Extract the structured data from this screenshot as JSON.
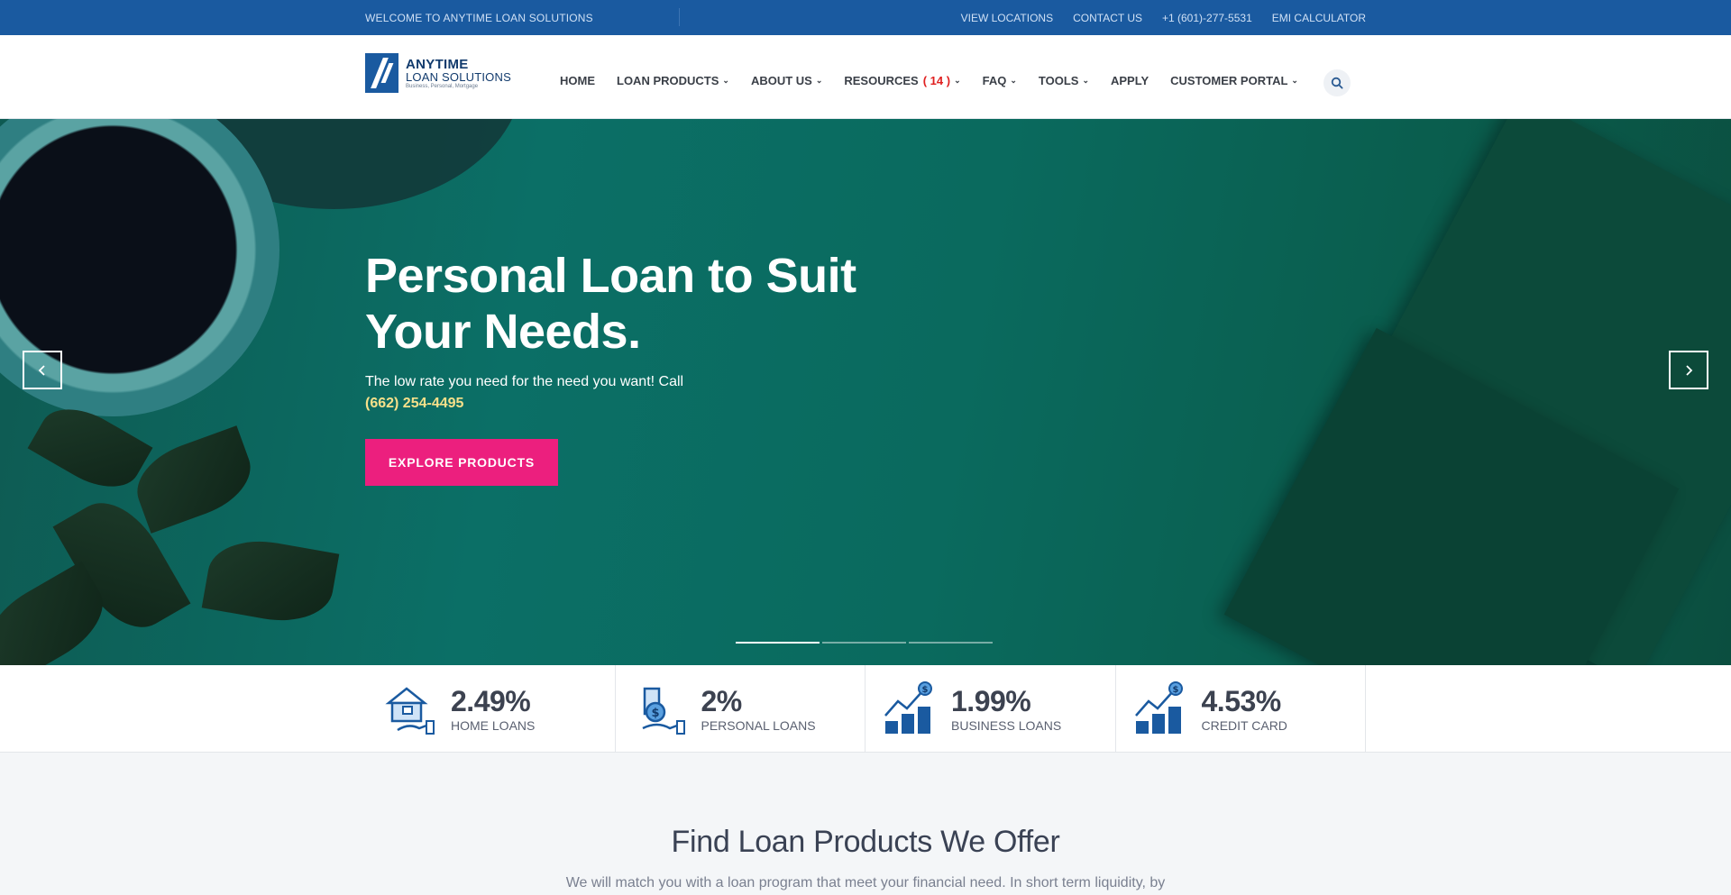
{
  "topbar": {
    "welcome": "WELCOME TO ANYTIME LOAN SOLUTIONS",
    "links": [
      "VIEW LOCATIONS",
      "CONTACT US",
      "+1 (601)-277-5531",
      "EMI CALCULATOR"
    ]
  },
  "logo": {
    "line1": "ANYTIME",
    "line2": "LOAN SOLUTIONS",
    "line3": "Business, Personal, Mortgage"
  },
  "nav": {
    "home": "HOME",
    "loan_products": "LOAN PRODUCTS",
    "about_us": "ABOUT US",
    "resources": "RESOURCES",
    "resources_count": "( 14 )",
    "faq": "FAQ",
    "tools": "TOOLS",
    "apply": "APPLY",
    "customer_portal": "CUSTOMER PORTAL"
  },
  "hero": {
    "title_line1": "Personal Loan to Suit",
    "title_line2": "Your Needs.",
    "subtitle": "The low rate you need for the need you want! Call",
    "phone": "(662) 254-4495",
    "cta": "EXPLORE PRODUCTS",
    "slide_count": 3,
    "active_slide": 1
  },
  "rates": [
    {
      "value": "2.49%",
      "label": "HOME LOANS",
      "icon": "home-loan-icon"
    },
    {
      "value": "2%",
      "label": "PERSONAL LOANS",
      "icon": "personal-loan-icon"
    },
    {
      "value": "1.99%",
      "label": "BUSINESS LOANS",
      "icon": "business-loan-icon"
    },
    {
      "value": "4.53%",
      "label": "CREDIT CARD",
      "icon": "credit-card-icon"
    }
  ],
  "products": {
    "heading": "Find Loan Products We Offer",
    "intro": "We will match you with a loan program that meet your financial need. In short term liquidity, by"
  },
  "colors": {
    "topbar": "#1a5aa0",
    "accent_pink": "#ec1f7e",
    "phone_yellow": "#f7e08a",
    "badge_red": "#e02020"
  }
}
